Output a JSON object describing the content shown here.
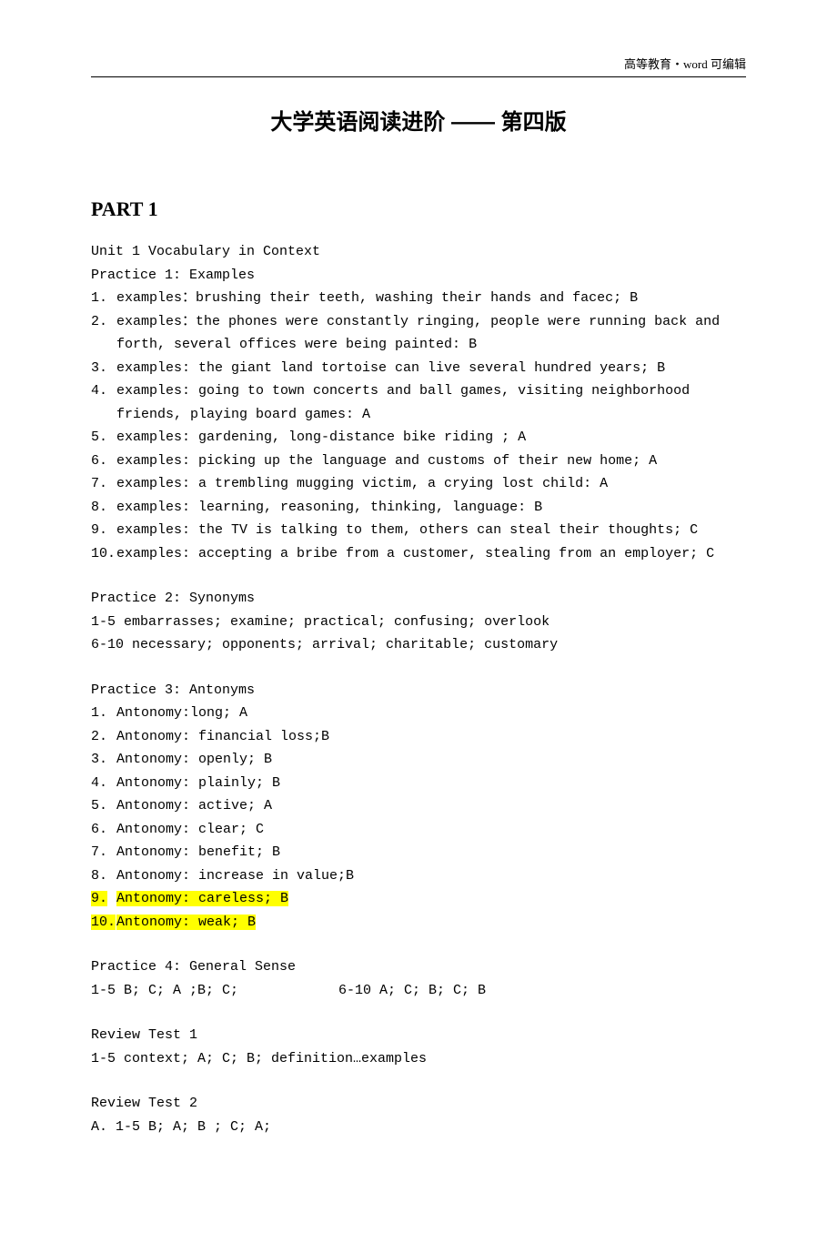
{
  "header": {
    "cn": "高等教育・",
    "word": "word",
    "editable": " 可编辑"
  },
  "title": "大学英语阅读进阶 —— 第四版",
  "part": "PART 1",
  "unit_line": "Unit 1   Vocabulary in Context",
  "practice1": {
    "heading": "Practice 1: Examples",
    "items": [
      {
        "n": "1.",
        "t": "examples：brushing their teeth, washing their hands and facec; B"
      },
      {
        "n": "2.",
        "t": "examples：the phones were constantly ringing, people were running back and forth, several offices were being painted: B"
      },
      {
        "n": "3.",
        "t": "examples: the giant land tortoise can live several hundred years; B"
      },
      {
        "n": "4.",
        "t": "examples: going to town concerts and ball games, visiting neighborhood friends, playing board games: A"
      },
      {
        "n": "5.",
        "t": "examples: gardening, long-distance bike riding ; A"
      },
      {
        "n": "6.",
        "t": "examples: picking up the language and customs of their new home; A"
      },
      {
        "n": "7.",
        "t": "examples: a trembling mugging victim, a crying lost child: A"
      },
      {
        "n": "8.",
        "t": "examples: learning, reasoning, thinking, language: B"
      },
      {
        "n": "9.",
        "t": "examples: the TV is talking to them, others can steal their thoughts; C"
      },
      {
        "n": "10.",
        "t": "examples:  accepting a bribe from a customer, stealing from an employer; C"
      }
    ]
  },
  "practice2": {
    "heading": "Practice 2: Synonyms",
    "line1": "1-5  embarrasses; examine; practical; confusing; overlook",
    "line2": "6-10 necessary; opponents; arrival; charitable; customary"
  },
  "practice3": {
    "heading": "Practice 3: Antonyms",
    "items": [
      {
        "n": "1.",
        "t": "Antonomy:long; A",
        "hl": false
      },
      {
        "n": "2.",
        "t": "Antonomy: financial loss;B",
        "hl": false
      },
      {
        "n": "3.",
        "t": "Antonomy: openly; B",
        "hl": false
      },
      {
        "n": "4.",
        "t": "Antonomy: plainly; B",
        "hl": false
      },
      {
        "n": "5.",
        "t": "Antonomy: active; A",
        "hl": false
      },
      {
        "n": "6.",
        "t": "Antonomy: clear; C",
        "hl": false
      },
      {
        "n": "7.",
        "t": "Antonomy: benefit; B",
        "hl": false
      },
      {
        "n": "8.",
        "t": "Antonomy: increase in value;B",
        "hl": false
      },
      {
        "n": "9.",
        "t": "Antonomy: careless; B",
        "hl": true
      },
      {
        "n": "10.",
        "t": "Antonomy: weak; B",
        "hl": true
      }
    ]
  },
  "practice4": {
    "heading": "Practice 4:  General Sense",
    "left": "1-5  B; C; A ;B; C;",
    "right": "6-10   A; C; B; C; B"
  },
  "review1": {
    "heading": "Review Test 1",
    "line": "1-5  context;  A; C; B; definition…examples"
  },
  "review2": {
    "heading": "Review Test 2",
    "line": "A.  1-5  B; A; B ; C; A;"
  }
}
